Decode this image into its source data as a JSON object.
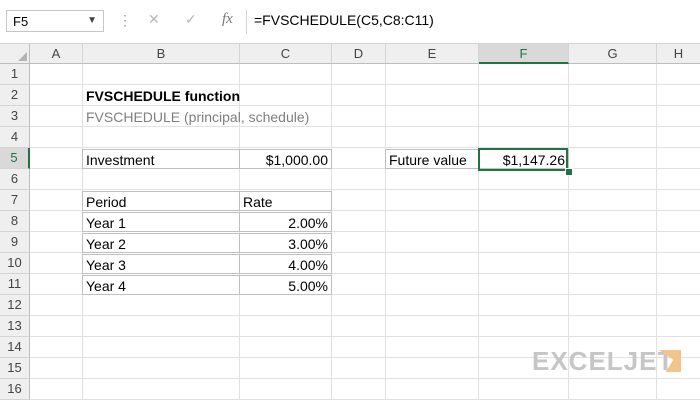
{
  "formula_bar": {
    "name_box": "F5",
    "formula": "=FVSCHEDULE(C5,C8:C11)",
    "cancel_icon": "close-icon",
    "enter_icon": "checkmark-icon",
    "fx_label": "fx"
  },
  "grid": {
    "columns": [
      "A",
      "B",
      "C",
      "D",
      "E",
      "F",
      "G",
      "H"
    ],
    "rows": [
      "1",
      "2",
      "3",
      "4",
      "5",
      "6",
      "7",
      "8",
      "9",
      "10",
      "11",
      "12",
      "13",
      "14",
      "15",
      "16"
    ],
    "selected_cell": "F5"
  },
  "sheet": {
    "title": "FVSCHEDULE function",
    "syntax": "FVSCHEDULE (principal, schedule)",
    "investment_label": "Investment",
    "investment_value": "$1,000.00",
    "future_value_label": "Future value",
    "future_value": "$1,147.26",
    "table": {
      "headers": [
        "Period",
        "Rate"
      ],
      "rows": [
        {
          "period": "Year 1",
          "rate": "2.00%"
        },
        {
          "period": "Year 2",
          "rate": "3.00%"
        },
        {
          "period": "Year 3",
          "rate": "4.00%"
        },
        {
          "period": "Year 4",
          "rate": "5.00%"
        }
      ]
    }
  },
  "branding": {
    "logo_text": "EXCELJET"
  },
  "colors": {
    "accent": "#217346",
    "blue_fill": "#dce9f5",
    "green_fill": "#e2efda"
  }
}
